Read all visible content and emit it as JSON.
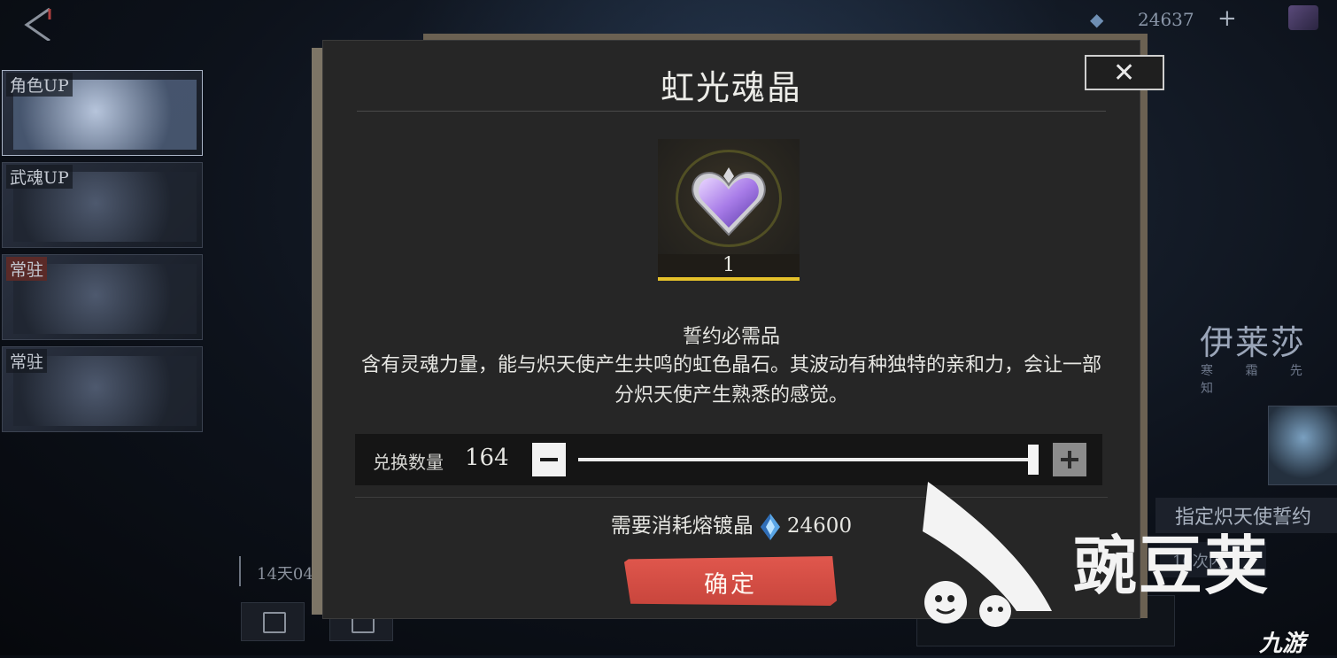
{
  "top_bar": {
    "currency_amount": "24637",
    "currency_plus": "+"
  },
  "side_tabs": [
    {
      "label": "角色UP"
    },
    {
      "label": "武魂UP"
    },
    {
      "label": "常驻"
    },
    {
      "label": "常驻"
    }
  ],
  "timer": "14天04",
  "right_panel": {
    "name": "伊莱莎",
    "subtitle": "寒 霜 先 知",
    "banner": "指定炽天使誓约",
    "banner2": "10次内"
  },
  "modal": {
    "title": "虹光魂晶",
    "close_icon": "close-icon",
    "item": {
      "icon": "heart-crystal-icon",
      "quantity": "1"
    },
    "desc_heading": "誓约必需品",
    "desc_body": "含有灵魂力量，能与炽天使产生共鸣的虹色晶石。其波动有种独特的亲和力，会让一部分炽天使产生熟悉的感觉。",
    "exchange_label": "兑换数量",
    "exchange_value": "164",
    "slider_fraction": 1.0,
    "cost_label": "需要消耗熔镀晶",
    "cost_value": "24600",
    "confirm_label": "确定"
  },
  "watermark": {
    "text": "豌豆荚",
    "corner": "九游"
  },
  "colors": {
    "accent_yellow": "#e5c12a",
    "confirm_red": "#d44d44",
    "modal_bg": "#262626"
  }
}
